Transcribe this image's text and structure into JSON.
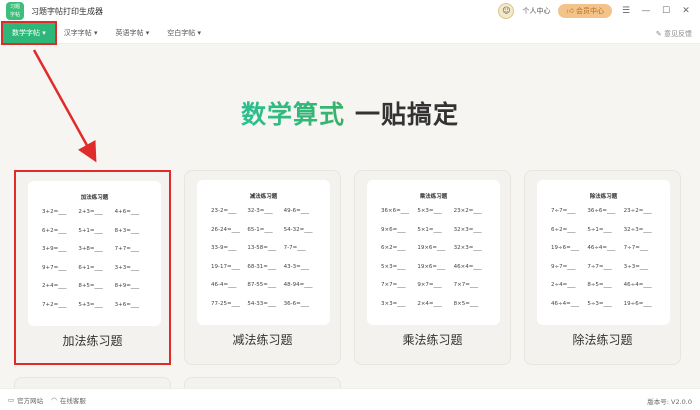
{
  "app": {
    "title": "习题字帖打印生成器",
    "logo_text": "习题字帖"
  },
  "top_right": {
    "personal": "个人中心",
    "vip": "会员中心"
  },
  "nav": {
    "tabs": [
      "数学字帖",
      "汉字字帖",
      "英语字帖",
      "空白字帖"
    ],
    "feedback": "意见反馈"
  },
  "headline": {
    "part1": "数学算式",
    "part2": "一贴搞定"
  },
  "cards": [
    {
      "title": "加法练习题",
      "label": "加法练习题",
      "problems": [
        "3+2=",
        "2+3=",
        "4+6=",
        "6+2=",
        "5+1=",
        "8+3=",
        "3+9=",
        "3+8=",
        "7+7=",
        "9+7=",
        "6+1=",
        "3+3=",
        "2+4=",
        "8+5=",
        "8+9=",
        "7+2=",
        "5+3=",
        "3+6="
      ]
    },
    {
      "title": "减法练习题",
      "label": "减法练习题",
      "problems": [
        "23-2=",
        "32-3=",
        "49-6=",
        "26-24=",
        "65-1=",
        "54-32=",
        "33-9=",
        "13-58=",
        "7-7=",
        "19-17=",
        "68-31=",
        "43-3=",
        "46-4=",
        "87-55=",
        "48-94=",
        "77-25=",
        "54-33=",
        "36-6="
      ]
    },
    {
      "title": "乘法练习题",
      "label": "乘法练习题",
      "problems": [
        "36×6=",
        "5×3=",
        "23×2=",
        "9×6=",
        "5×1=",
        "32×3=",
        "6×2=",
        "19×6=",
        "32×3=",
        "5×3=",
        "19×6=",
        "46×4=",
        "7×7=",
        "9×7=",
        "7×7=",
        "3×3=",
        "2×4=",
        "8×5="
      ]
    },
    {
      "title": "除法练习题",
      "label": "除法练习题",
      "problems": [
        "7÷7=",
        "36÷6=",
        "23÷2=",
        "6÷2=",
        "5÷1=",
        "32÷3=",
        "19÷6=",
        "46÷4=",
        "7÷7=",
        "9÷7=",
        "7÷7=",
        "3÷3=",
        "2÷4=",
        "8÷5=",
        "46÷4=",
        "46÷4=",
        "5÷3=",
        "19÷6="
      ]
    }
  ],
  "footer": {
    "website": "官方网站",
    "support": "在线客服",
    "version": "版本号: V2.0.0"
  },
  "colors": {
    "accent": "#2db87a",
    "highlight": "#e02b2b"
  }
}
